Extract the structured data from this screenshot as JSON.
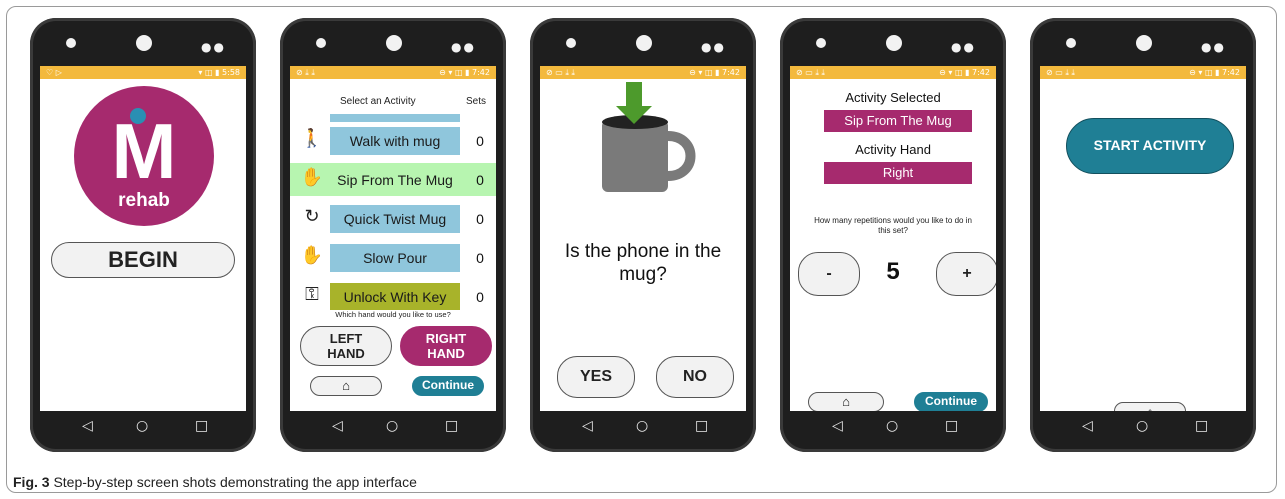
{
  "phones": [
    {
      "status_left": "♡ ▷",
      "status_right": "▾ ◫ ▮ 5:58",
      "logo_letter": "M",
      "logo_text": "rehab",
      "begin_label": "BEGIN"
    },
    {
      "status_left": "⊘ ⤓ ⤓",
      "status_right": "⊖ ▾ ◫ ▮ 7:42",
      "header_activity": "Select an Activity",
      "header_sets": "Sets",
      "activities": [
        {
          "label": "Walk with mug",
          "sets": "0"
        },
        {
          "label": "Sip From The Mug",
          "sets": "0"
        },
        {
          "label": "Quick Twist Mug",
          "sets": "0"
        },
        {
          "label": "Slow Pour",
          "sets": "0"
        },
        {
          "label": "Unlock With Key",
          "sets": "0"
        }
      ],
      "hand_question": "Which hand would you like to use?",
      "left_hand": "LEFT\nHAND",
      "right_hand": "RIGHT\nHAND",
      "continue_label": "Continue"
    },
    {
      "status_left": "⊘ ▭ ⤓ ⤓",
      "status_right": "⊖ ▾ ◫ ▮ 7:42",
      "question": "Is the phone in the mug?",
      "yes_label": "YES",
      "no_label": "NO"
    },
    {
      "status_left": "⊘ ▭ ⤓ ⤓",
      "status_right": "⊖ ▾ ◫ ▮ 7:42",
      "activity_selected_label": "Activity Selected",
      "activity_selected_value": "Sip From The Mug",
      "activity_hand_label": "Activity Hand",
      "activity_hand_value": "Right",
      "reps_question": "How many repetitions would you like to do in this set?",
      "minus_label": "-",
      "reps_value": "5",
      "plus_label": "+",
      "continue_label": "Continue"
    },
    {
      "status_left": "⊘ ▭ ⤓ ⤓",
      "status_right": "⊖ ▾ ◫ ▮ 7:42",
      "start_label": "START ACTIVITY"
    }
  ],
  "nav": {
    "back": "◁",
    "home": "○",
    "recent": "□"
  },
  "caption_bold": "Fig. 3",
  "caption_text": " Step-by-step screen shots demonstrating the app interface",
  "colors": {
    "status": "#f3b93d",
    "magenta": "#a62a6e",
    "teal": "#1f7f95",
    "light_blue": "#8fc6dc",
    "highlight": "#b7f5b0",
    "olive": "#a8b32a"
  }
}
